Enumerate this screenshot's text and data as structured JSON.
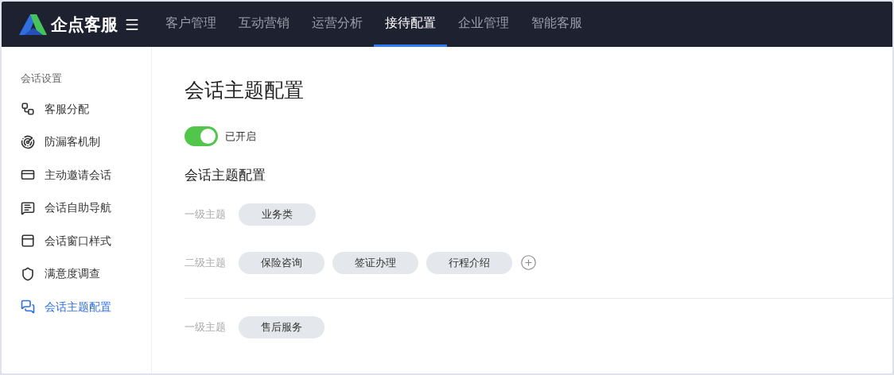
{
  "brand": {
    "name": "企点客服"
  },
  "nav": [
    {
      "label": "客户管理",
      "selected": false
    },
    {
      "label": "互动营销",
      "selected": false
    },
    {
      "label": "运营分析",
      "selected": false
    },
    {
      "label": "接待配置",
      "selected": true
    },
    {
      "label": "企业管理",
      "selected": false
    },
    {
      "label": "智能客服",
      "selected": false
    }
  ],
  "sidebar": {
    "section": "会话设置",
    "items": [
      {
        "label": "客服分配",
        "selected": false
      },
      {
        "label": "防漏客机制",
        "selected": false
      },
      {
        "label": "主动邀请会话",
        "selected": false
      },
      {
        "label": "会话自助导航",
        "selected": false
      },
      {
        "label": "会话窗口样式",
        "selected": false
      },
      {
        "label": "满意度调查",
        "selected": false
      },
      {
        "label": "会话主题配置",
        "selected": true
      }
    ]
  },
  "page": {
    "title": "会话主题配置",
    "toggle": {
      "on": true,
      "label": "已开启"
    },
    "section_title": "会话主题配置",
    "groups": [
      {
        "rows": [
          {
            "label": "一级主题",
            "tags": [
              "业务类"
            ],
            "addable": false
          },
          {
            "label": "二级主题",
            "tags": [
              "保险咨询",
              "签证办理",
              "行程介绍"
            ],
            "addable": true
          }
        ]
      },
      {
        "rows": [
          {
            "label": "一级主题",
            "tags": [
              "售后服务"
            ],
            "addable": false
          }
        ]
      }
    ]
  }
}
